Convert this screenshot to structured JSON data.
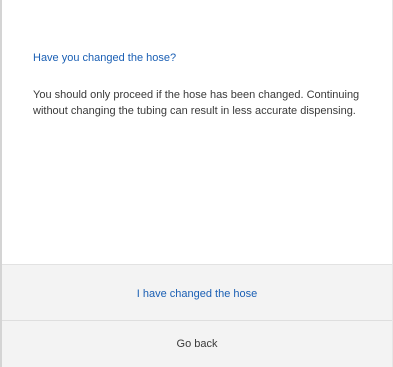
{
  "dialog": {
    "title": "Have you changed the hose?",
    "message": "You should only proceed if the hose has been changed. Continuing without changing the tubing can result in less accurate dispensing.",
    "primary_button": "I have changed the hose",
    "secondary_button": "Go back"
  },
  "colors": {
    "accent": "#1a5fb4",
    "text": "#3a3a3a",
    "footer_background": "#f3f3f3"
  }
}
